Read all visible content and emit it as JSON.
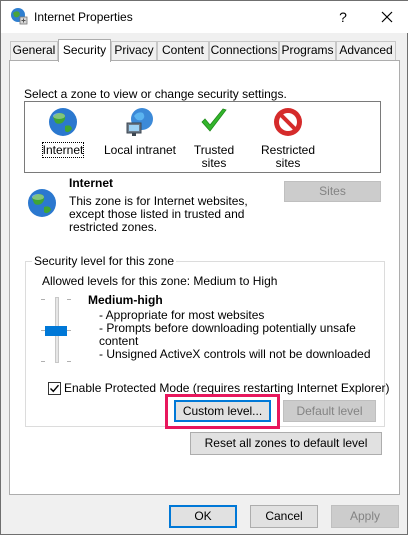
{
  "window": {
    "title": "Internet Properties",
    "help": "?"
  },
  "tabs": [
    {
      "label": "General"
    },
    {
      "label": "Security"
    },
    {
      "label": "Privacy"
    },
    {
      "label": "Content"
    },
    {
      "label": "Connections"
    },
    {
      "label": "Programs"
    },
    {
      "label": "Advanced"
    }
  ],
  "security": {
    "instruction": "Select a zone to view or change security settings.",
    "zones": [
      {
        "label": "Internet",
        "icon": "globe-icon"
      },
      {
        "label": "Local intranet",
        "icon": "network-globe-icon"
      },
      {
        "label": "Trusted sites",
        "icon": "green-checkmark-icon"
      },
      {
        "label_line1": "Restricted",
        "label_line2": "sites",
        "icon": "no-entry-icon"
      }
    ],
    "selected_zone": {
      "name": "Internet",
      "desc_line1": "This zone is for Internet websites,",
      "desc_line2": "except those listed in trusted and",
      "desc_line3": "restricted zones."
    },
    "sites_button": "Sites",
    "level_group": {
      "title": "Security level for this zone",
      "allowed": "Allowed levels for this zone: Medium to High",
      "level_name": "Medium-high",
      "bullets": [
        "- Appropriate for most websites",
        "- Prompts before downloading potentially unsafe",
        "content",
        "- Unsigned ActiveX controls will not be downloaded"
      ],
      "protected_mode": "Enable Protected Mode (requires restarting Internet Explorer)",
      "protected_mode_checked": true,
      "custom_level": "Custom level...",
      "default_level": "Default level"
    },
    "reset_all": "Reset all zones to default level"
  },
  "footer": {
    "ok": "OK",
    "cancel": "Cancel",
    "apply": "Apply"
  },
  "colors": {
    "accent": "#0078d7",
    "highlight": "#e8175d"
  }
}
